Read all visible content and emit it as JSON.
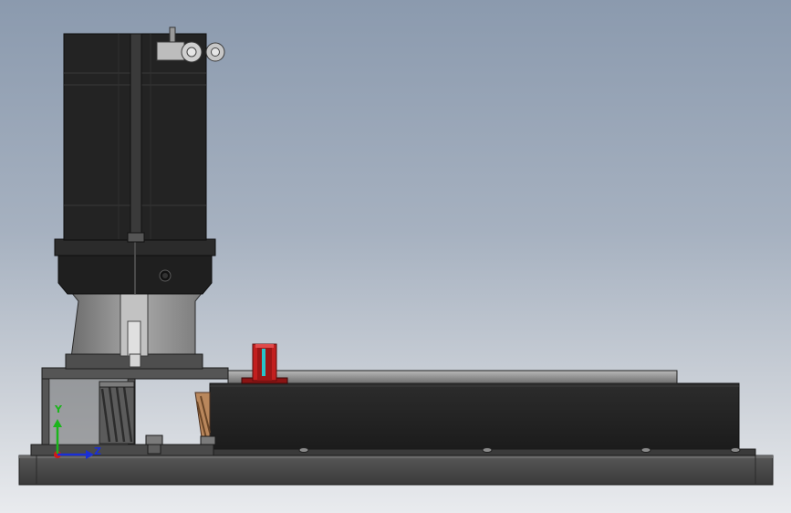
{
  "viewport": {
    "background_top": "#8b9aae",
    "background_bottom": "#e9ebee"
  },
  "triad": {
    "y_label": "Y",
    "x_label": "Z",
    "y_color": "#1bb51b",
    "x_color": "#1a2fd6",
    "z_color": "#d01919"
  },
  "model": {
    "body_color": "#2b2b2b",
    "metal_color": "#9a9a9a",
    "bracket_color": "#c21f1f",
    "bracket_slot_color": "#27c3c9",
    "copper_color": "#b9875c"
  }
}
